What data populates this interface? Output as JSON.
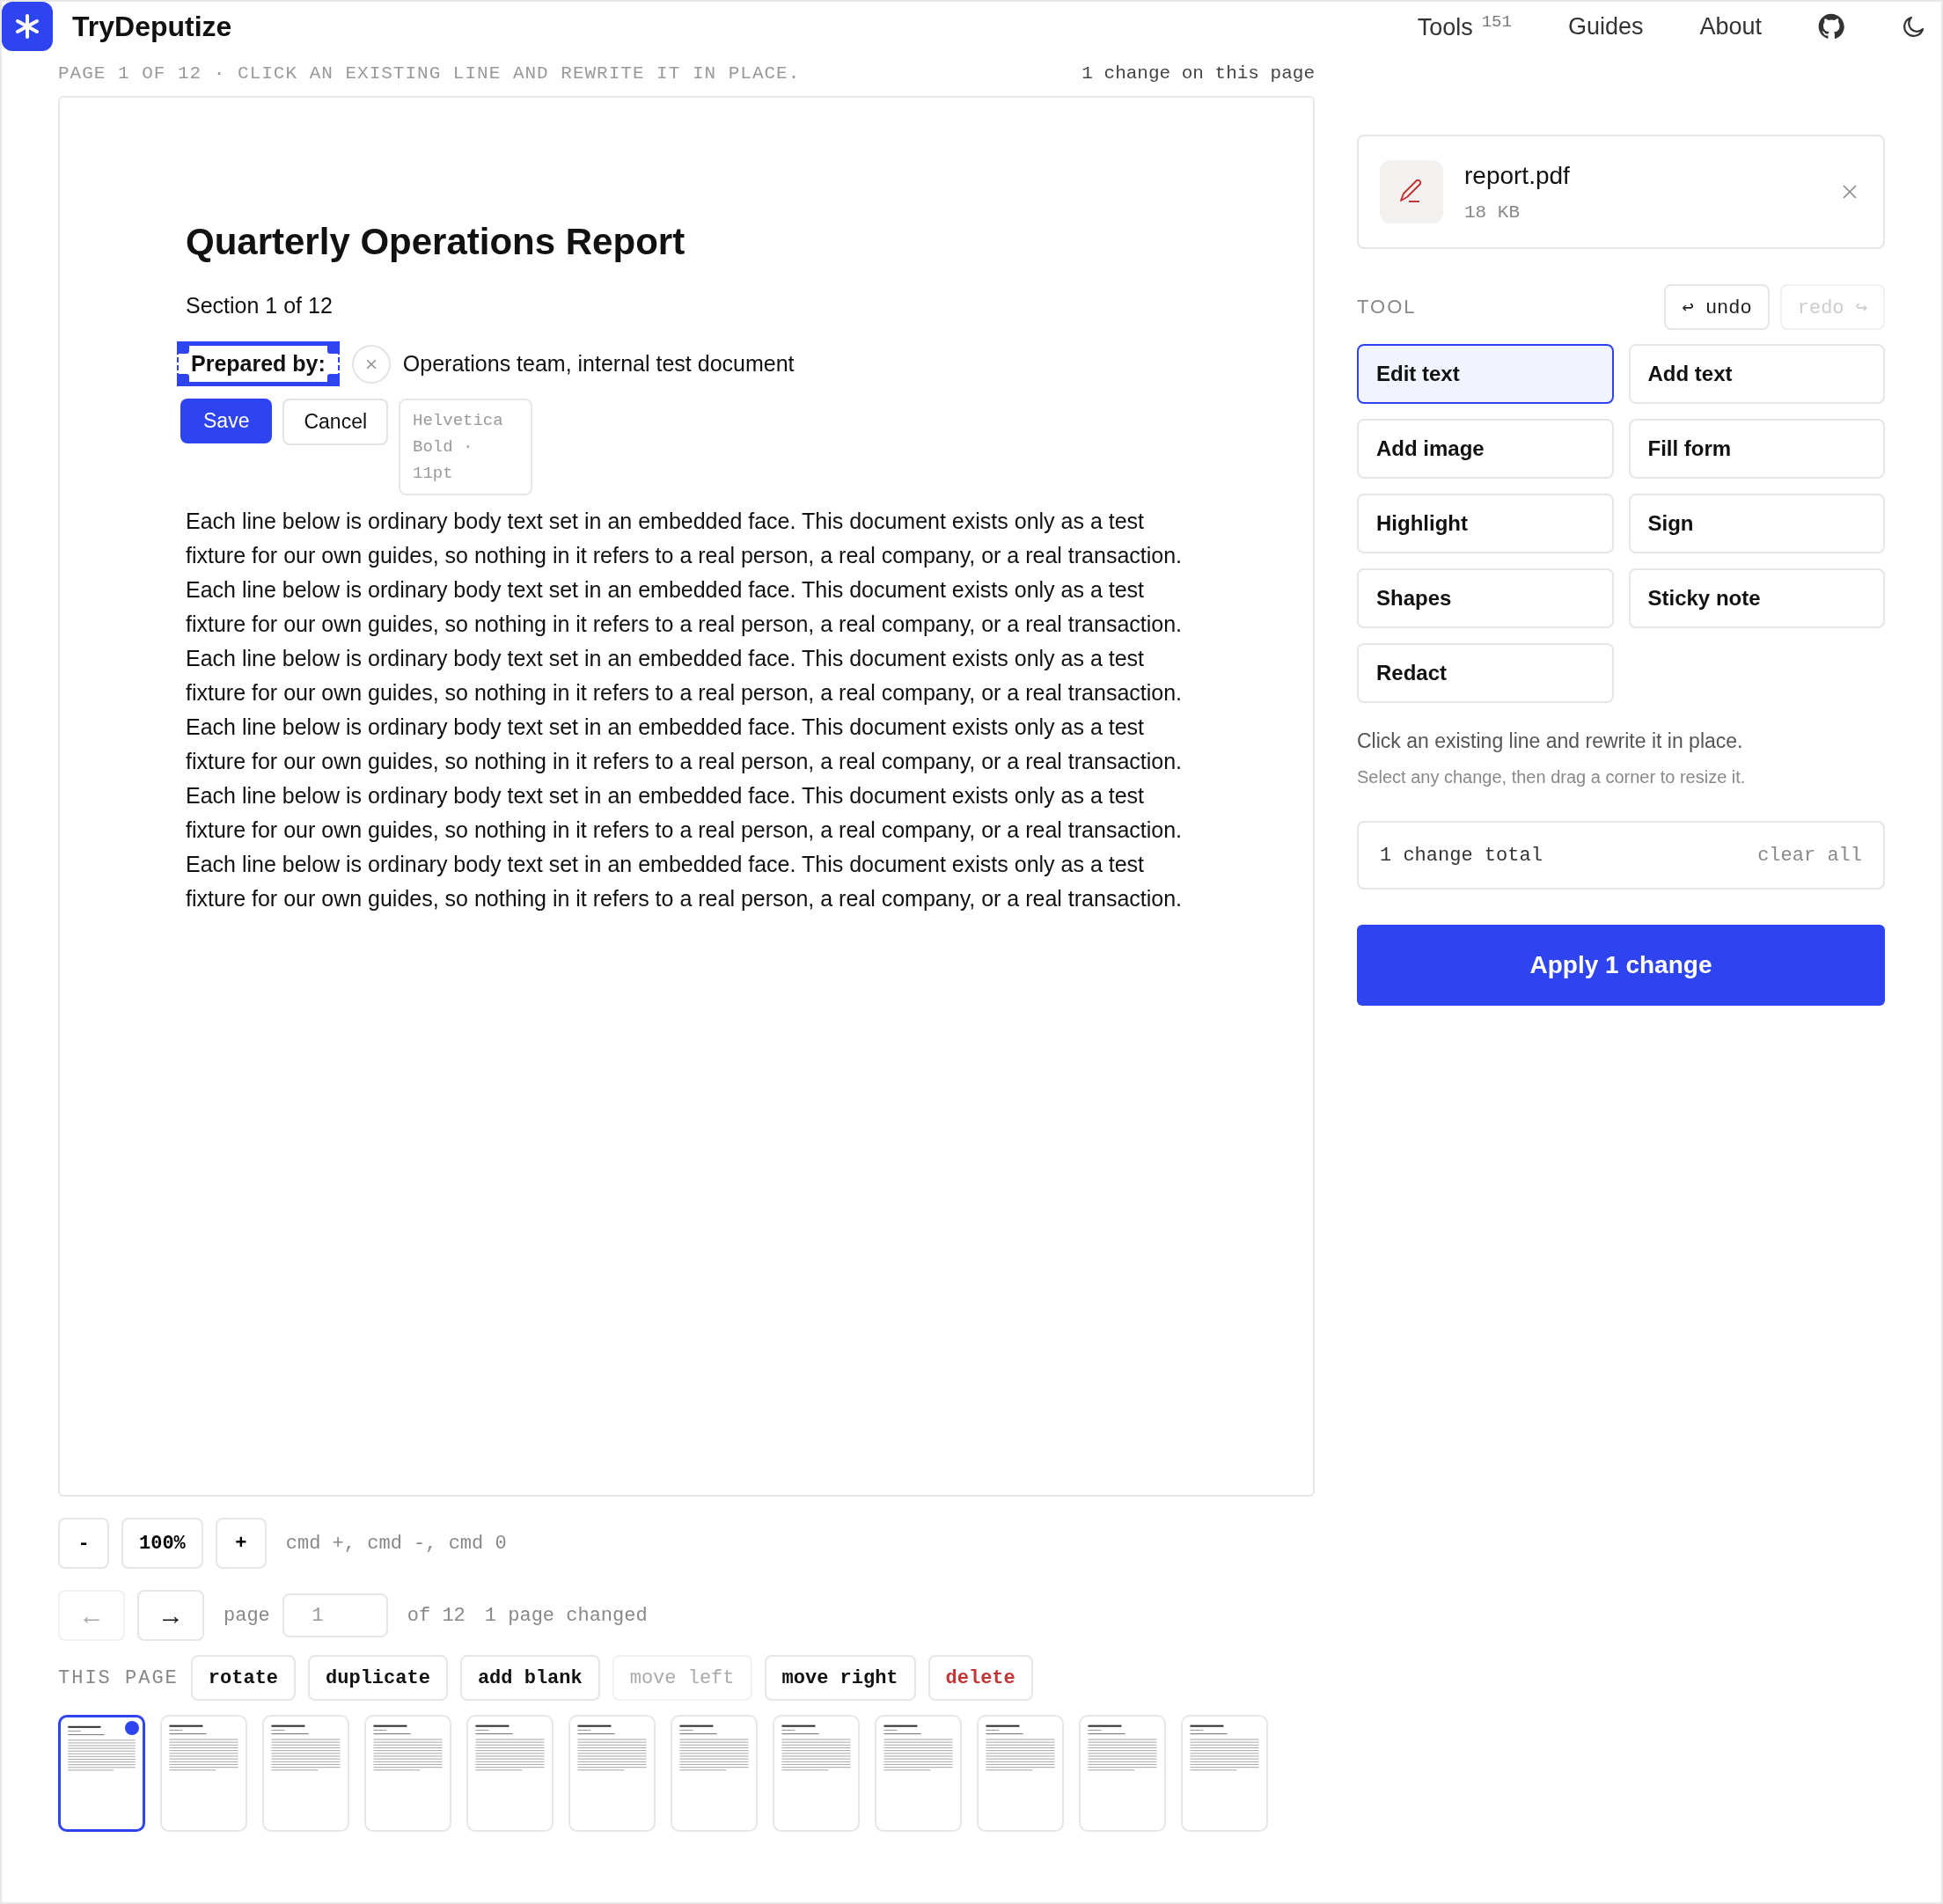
{
  "header": {
    "brand": "TryDeputize",
    "nav": [
      {
        "label": "Tools",
        "badge": "151"
      },
      {
        "label": "Guides"
      },
      {
        "label": "About"
      }
    ]
  },
  "status": {
    "left": "PAGE 1 OF 12 · CLICK AN EXISTING LINE AND REWRITE IT IN PLACE.",
    "right": "1 change on this page"
  },
  "document": {
    "title": "Quarterly Operations Report",
    "subtitle": "Section 1 of 12",
    "edited_line": {
      "label": "Prepared by:",
      "rest": "Operations team, internal test document"
    },
    "editor": {
      "save": "Save",
      "cancel": "Cancel",
      "font_info": "Helvetica Bold · 11pt"
    },
    "paragraph": "Each line below is ordinary body text set in an embedded face. This document exists only as a test fixture for our own guides, so nothing in it refers to a real person, a real company, or a real transaction. Each line below is ordinary body text set in an embedded face. This document exists only as a test fixture for our own guides, so nothing in it refers to a real person, a real company, or a real transaction. Each line below is ordinary body text set in an embedded face. This document exists only as a test fixture for our own guides, so nothing in it refers to a real person, a real company, or a real transaction. Each line below is ordinary body text set in an embedded face. This document exists only as a test fixture for our own guides, so nothing in it refers to a real person, a real company, or a real transaction. Each line below is ordinary body text set in an embedded face. This document exists only as a test fixture for our own guides, so nothing in it refers to a real person, a real company, or a real transaction. Each line below is ordinary body text set in an embedded face. This document exists only as a test fixture for our own guides, so nothing in it refers to a real person, a real company, or a real transaction."
  },
  "zoom": {
    "minus": "-",
    "value": "100%",
    "plus": "+",
    "hint": "cmd +, cmd -, cmd 0"
  },
  "pager": {
    "arrows": [
      {
        "label": "←",
        "disabled": true
      },
      {
        "label": "→",
        "disabled": false
      }
    ],
    "page_label": "page",
    "page_value": "1",
    "of": "of 12",
    "changed": "1 page changed"
  },
  "page_actions": {
    "label": "THIS PAGE",
    "actions": [
      {
        "label": "rotate",
        "kind": "normal"
      },
      {
        "label": "duplicate",
        "kind": "normal"
      },
      {
        "label": "add blank",
        "kind": "normal"
      },
      {
        "label": "move left",
        "kind": "disabled"
      },
      {
        "label": "move right",
        "kind": "normal"
      },
      {
        "label": "delete",
        "kind": "danger"
      }
    ]
  },
  "thumbnails": [
    {
      "selected": true
    },
    {
      "selected": false
    },
    {
      "selected": false
    },
    {
      "selected": false
    },
    {
      "selected": false
    },
    {
      "selected": false
    },
    {
      "selected": false
    },
    {
      "selected": false
    },
    {
      "selected": false
    },
    {
      "selected": false
    },
    {
      "selected": false
    },
    {
      "selected": false
    }
  ],
  "sidebar": {
    "file": {
      "name": "report.pdf",
      "size": "18 KB"
    },
    "tool_label": "TOOL",
    "undo": {
      "label": "↩ undo",
      "disabled": false
    },
    "redo": {
      "label": "redo ↪",
      "disabled": true
    },
    "tools": [
      {
        "label": "Edit text",
        "selected": true
      },
      {
        "label": "Add text",
        "selected": false
      },
      {
        "label": "Add image",
        "selected": false
      },
      {
        "label": "Fill form",
        "selected": false
      },
      {
        "label": "Highlight",
        "selected": false
      },
      {
        "label": "Sign",
        "selected": false
      },
      {
        "label": "Shapes",
        "selected": false
      },
      {
        "label": "Sticky note",
        "selected": false
      },
      {
        "label": "Redact",
        "selected": false
      }
    ],
    "hint": "Click an existing line and rewrite it in place.",
    "subhint": "Select any change, then drag a corner to resize it.",
    "changes": {
      "total": "1 change total",
      "clear": "clear all"
    },
    "apply": "Apply 1 change"
  }
}
